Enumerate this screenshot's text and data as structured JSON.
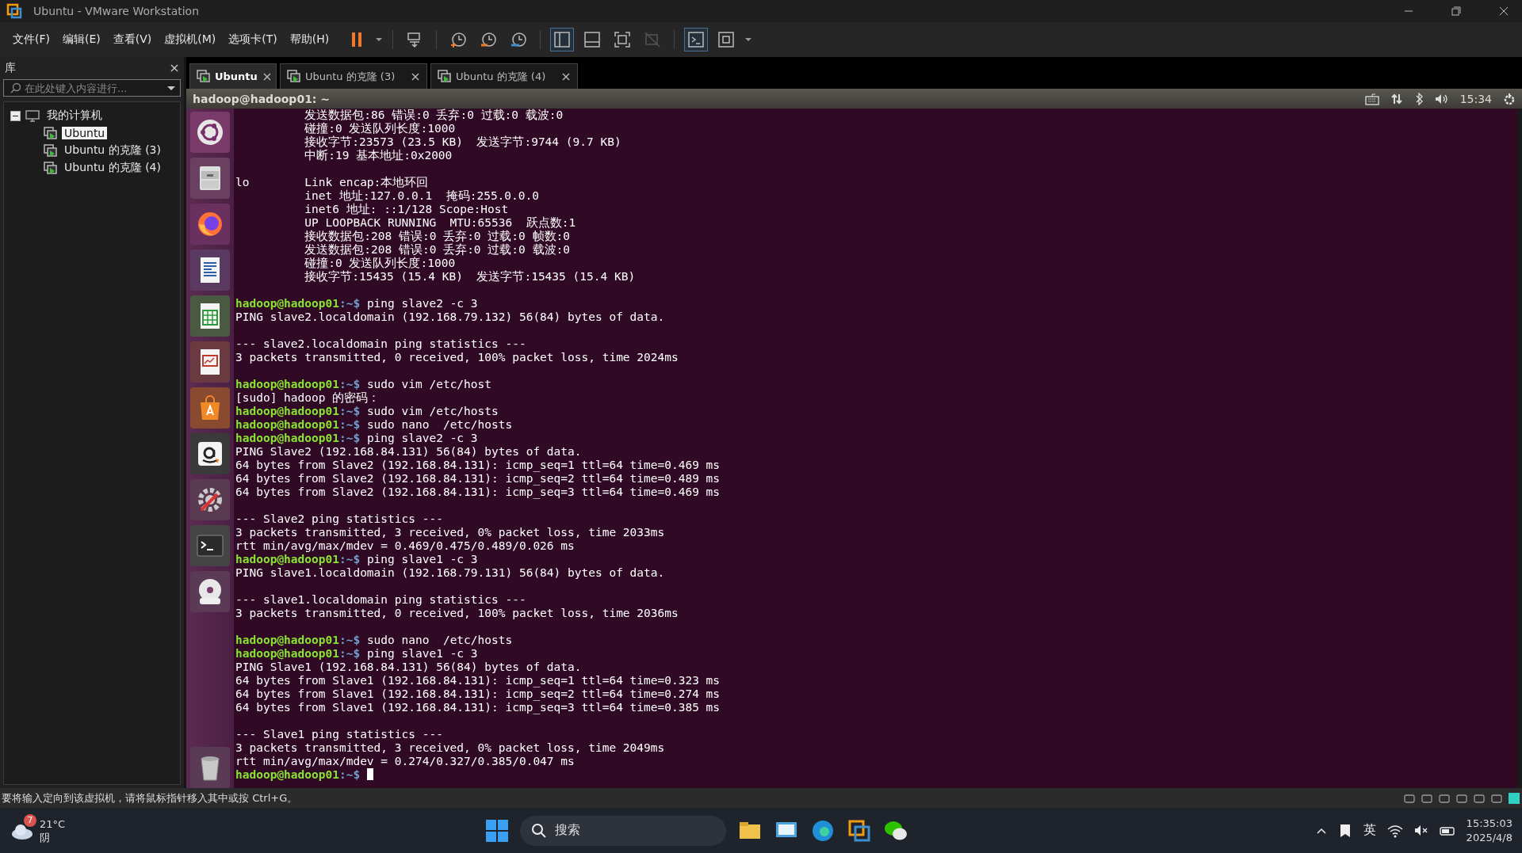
{
  "window": {
    "title": "Ubuntu - VMware Workstation"
  },
  "menu": [
    "文件(F)",
    "编辑(E)",
    "查看(V)",
    "虚拟机(M)",
    "选项卡(T)",
    "帮助(H)"
  ],
  "library": {
    "title": "库",
    "search": {
      "placeholder": "在此处键入内容进行..."
    },
    "tree": [
      {
        "label": "我的计算机",
        "expanded": true,
        "children": [
          {
            "label": "Ubuntu",
            "selected": true
          },
          {
            "label": "Ubuntu 的克隆 (3)",
            "selected": false
          },
          {
            "label": "Ubuntu 的克隆 (4)",
            "selected": false
          }
        ]
      }
    ]
  },
  "tabs": [
    {
      "label": "Ubuntu",
      "selected": true
    },
    {
      "label": "Ubuntu 的克隆 (3)",
      "selected": false
    },
    {
      "label": "Ubuntu 的克隆 (4)",
      "selected": false
    }
  ],
  "guest": {
    "title": "hadoop@hadoop01: ~",
    "clock": "15:34",
    "terminal": [
      {
        "kind": "output",
        "text": "          发送数据包:86 错误:0 丢弃:0 过载:0 载波:0"
      },
      {
        "kind": "output",
        "text": "          碰撞:0 发送队列长度:1000"
      },
      {
        "kind": "output",
        "text": "          接收字节:23573 (23.5 KB)  发送字节:9744 (9.7 KB)"
      },
      {
        "kind": "output",
        "text": "          中断:19 基本地址:0x2000"
      },
      {
        "kind": "blank"
      },
      {
        "kind": "output",
        "text": "lo        Link encap:本地环回"
      },
      {
        "kind": "output",
        "text": "          inet 地址:127.0.0.1  掩码:255.0.0.0"
      },
      {
        "kind": "output",
        "text": "          inet6 地址: ::1/128 Scope:Host"
      },
      {
        "kind": "output",
        "text": "          UP LOOPBACK RUNNING  MTU:65536  跃点数:1"
      },
      {
        "kind": "output",
        "text": "          接收数据包:208 错误:0 丢弃:0 过载:0 帧数:0"
      },
      {
        "kind": "output",
        "text": "          发送数据包:208 错误:0 丢弃:0 过载:0 载波:0"
      },
      {
        "kind": "output",
        "text": "          碰撞:0 发送队列长度:1000"
      },
      {
        "kind": "output",
        "text": "          接收字节:15435 (15.4 KB)  发送字节:15435 (15.4 KB)"
      },
      {
        "kind": "blank"
      },
      {
        "kind": "prompt",
        "user": "hadoop@hadoop01",
        "path": ":~$",
        "command": "ping slave2 -c 3"
      },
      {
        "kind": "output",
        "text": "PING slave2.localdomain (192.168.79.132) 56(84) bytes of data."
      },
      {
        "kind": "blank"
      },
      {
        "kind": "output",
        "text": "--- slave2.localdomain ping statistics ---"
      },
      {
        "kind": "output",
        "text": "3 packets transmitted, 0 received, 100% packet loss, time 2024ms"
      },
      {
        "kind": "blank"
      },
      {
        "kind": "prompt",
        "user": "hadoop@hadoop01",
        "path": ":~$",
        "command": "sudo vim /etc/host"
      },
      {
        "kind": "output",
        "text": "[sudo] hadoop 的密码："
      },
      {
        "kind": "prompt",
        "user": "hadoop@hadoop01",
        "path": ":~$",
        "command": "sudo vim /etc/hosts"
      },
      {
        "kind": "prompt",
        "user": "hadoop@hadoop01",
        "path": ":~$",
        "command": "sudo nano  /etc/hosts"
      },
      {
        "kind": "prompt",
        "user": "hadoop@hadoop01",
        "path": ":~$",
        "command": "ping slave2 -c 3"
      },
      {
        "kind": "output",
        "text": "PING Slave2 (192.168.84.131) 56(84) bytes of data."
      },
      {
        "kind": "output",
        "text": "64 bytes from Slave2 (192.168.84.131): icmp_seq=1 ttl=64 time=0.469 ms"
      },
      {
        "kind": "output",
        "text": "64 bytes from Slave2 (192.168.84.131): icmp_seq=2 ttl=64 time=0.489 ms"
      },
      {
        "kind": "output",
        "text": "64 bytes from Slave2 (192.168.84.131): icmp_seq=3 ttl=64 time=0.469 ms"
      },
      {
        "kind": "blank"
      },
      {
        "kind": "output",
        "text": "--- Slave2 ping statistics ---"
      },
      {
        "kind": "output",
        "text": "3 packets transmitted, 3 received, 0% packet loss, time 2033ms"
      },
      {
        "kind": "output",
        "text": "rtt min/avg/max/mdev = 0.469/0.475/0.489/0.026 ms"
      },
      {
        "kind": "prompt",
        "user": "hadoop@hadoop01",
        "path": ":~$",
        "command": "ping slave1 -c 3"
      },
      {
        "kind": "output",
        "text": "PING slave1.localdomain (192.168.79.131) 56(84) bytes of data."
      },
      {
        "kind": "blank"
      },
      {
        "kind": "output",
        "text": "--- slave1.localdomain ping statistics ---"
      },
      {
        "kind": "output",
        "text": "3 packets transmitted, 0 received, 100% packet loss, time 2036ms"
      },
      {
        "kind": "blank"
      },
      {
        "kind": "prompt",
        "user": "hadoop@hadoop01",
        "path": ":~$",
        "command": "sudo nano  /etc/hosts"
      },
      {
        "kind": "prompt",
        "user": "hadoop@hadoop01",
        "path": ":~$",
        "command": "ping slave1 -c 3"
      },
      {
        "kind": "output",
        "text": "PING Slave1 (192.168.84.131) 56(84) bytes of data."
      },
      {
        "kind": "output",
        "text": "64 bytes from Slave1 (192.168.84.131): icmp_seq=1 ttl=64 time=0.323 ms"
      },
      {
        "kind": "output",
        "text": "64 bytes from Slave1 (192.168.84.131): icmp_seq=2 ttl=64 time=0.274 ms"
      },
      {
        "kind": "output",
        "text": "64 bytes from Slave1 (192.168.84.131): icmp_seq=3 ttl=64 time=0.385 ms"
      },
      {
        "kind": "blank"
      },
      {
        "kind": "output",
        "text": "--- Slave1 ping statistics ---"
      },
      {
        "kind": "output",
        "text": "3 packets transmitted, 3 received, 0% packet loss, time 2049ms"
      },
      {
        "kind": "output",
        "text": "rtt min/avg/max/mdev = 0.274/0.327/0.385/0.047 ms"
      },
      {
        "kind": "prompt",
        "user": "hadoop@hadoop01",
        "path": ":~$",
        "cursor": true
      }
    ]
  },
  "status_bar": {
    "text": "要将输入定向到该虚拟机，请将鼠标指针移入其中或按 Ctrl+G。"
  },
  "taskbar": {
    "weather": {
      "badge": "7",
      "temperature": "21°C",
      "condition": "阴"
    },
    "search": {
      "placeholder": "搜索"
    },
    "input_method": "英",
    "time": "15:35:03",
    "date": "2025/4/8"
  }
}
